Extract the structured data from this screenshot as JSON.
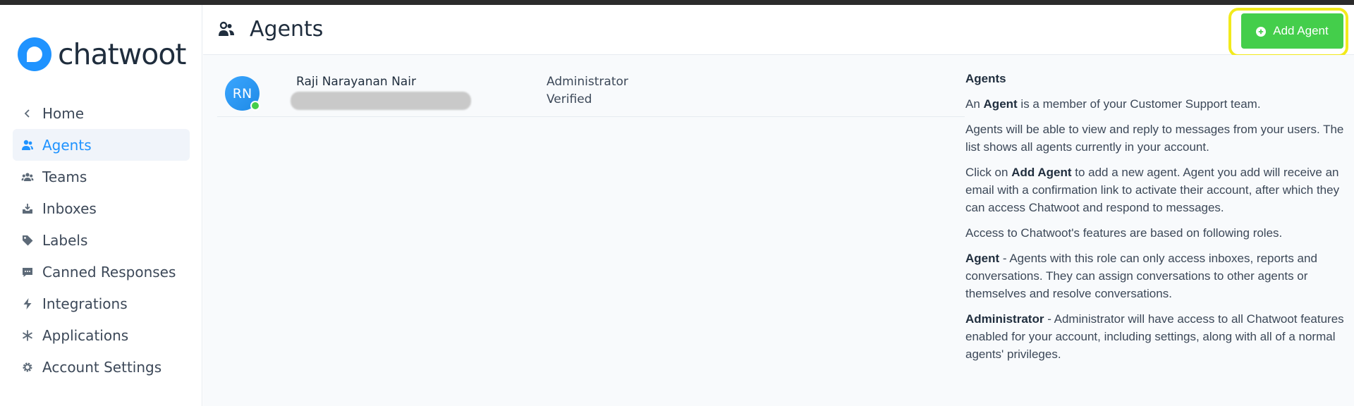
{
  "brand": {
    "name": "chatwoot",
    "accent": "#1f93ff"
  },
  "sidebar": {
    "items": [
      {
        "label": "Home",
        "icon": "chevron-left-icon"
      },
      {
        "label": "Agents",
        "icon": "people-icon",
        "active": true
      },
      {
        "label": "Teams",
        "icon": "team-icon"
      },
      {
        "label": "Inboxes",
        "icon": "inbox-icon"
      },
      {
        "label": "Labels",
        "icon": "tag-icon"
      },
      {
        "label": "Canned Responses",
        "icon": "chat-icon"
      },
      {
        "label": "Integrations",
        "icon": "bolt-icon"
      },
      {
        "label": "Applications",
        "icon": "asterisk-icon"
      },
      {
        "label": "Account Settings",
        "icon": "gear-icon"
      }
    ]
  },
  "header": {
    "title": "Agents",
    "icon": "people-icon",
    "add_button_label": "Add Agent",
    "add_button_color": "#44ce4b",
    "highlight_color": "#f2ea1c"
  },
  "agents": [
    {
      "initials": "RN",
      "name": "Raji Narayanan Nair",
      "role": "Administrator",
      "status": "Verified",
      "online": true
    }
  ],
  "help": {
    "title": "Agents",
    "p1_pre": "An ",
    "p1_bold": "Agent",
    "p1_post": " is a member of your Customer Support team.",
    "p2": "Agents will be able to view and reply to messages from your users. The list shows all agents currently in your account.",
    "p3_pre": "Click on ",
    "p3_bold": "Add Agent",
    "p3_post": " to add a new agent. Agent you add will receive an email with a confirmation link to activate their account, after which they can access Chatwoot and respond to messages.",
    "p4": "Access to Chatwoot's features are based on following roles.",
    "p5_bold": "Agent",
    "p5_post": " - Agents with this role can only access inboxes, reports and conversations. They can assign conversations to other agents or themselves and resolve conversations.",
    "p6_bold": "Administrator",
    "p6_post": " - Administrator will have access to all Chatwoot features enabled for your account, including settings, along with all of a normal agents' privileges."
  }
}
